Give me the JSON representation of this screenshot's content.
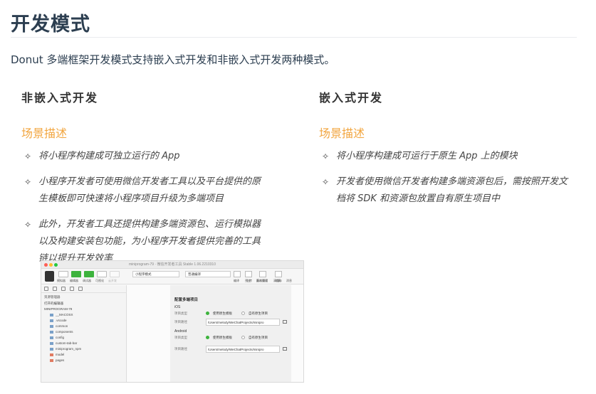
{
  "page": {
    "title": "开发模式",
    "intro": "Donut 多端框架开发模式支持嵌入式开发和非嵌入式开发两种模式。"
  },
  "colors": {
    "accent": "#f2a640",
    "heading": "#2c3e50",
    "green": "#3db33d"
  },
  "columns": [
    {
      "heading": "非嵌入式开发",
      "scene": "场景描述",
      "bullets": [
        "将小程序构建成可独立运行的 App",
        "小程序开发者可使用微信开发者工具以及平台提供的原生模板即可快速将小程序项目升级为多端项目",
        "此外，开发者工具还提供构建多端资源包、运行模拟器以及构建安装包功能，为小程序开发者提供完善的工具链以提升开发效率"
      ]
    },
    {
      "heading": "嵌入式开发",
      "scene": "场景描述",
      "bullets": [
        "将小程序构建成可运行于原生 App 上的模块",
        "开发者使用微信开发者构建多端资源包后，需按照开发文档将 SDK 和资源包放置自有原生项目中"
      ]
    }
  ],
  "bullet_icon": "diamond-star-icon",
  "devtool": {
    "window_title": "miniprogram-79 · 微信开发者工具 Stable 1.06.2210310",
    "toolbar_left_labels": [
      "模拟器",
      "编辑器",
      "调试器",
      "可视化",
      "云开发"
    ],
    "mode_select": "小程序模式",
    "compile_select": "普通编译",
    "toolbar_mid_labels": [
      "编译",
      "预览",
      "真机调试",
      "清缓存"
    ],
    "toolbar_right_labels": [
      "上传",
      "版本管理",
      "详情",
      "消息"
    ],
    "sidebar": {
      "header": "资源管理器",
      "sections": [
        "打开的编辑器",
        "MINIPROGRAM-79"
      ],
      "files": [
        "__MACOSX",
        ".vscode",
        "common",
        "components",
        "config",
        "custom-tab-bar",
        "miniprogram_npm",
        "model",
        "pages"
      ]
    },
    "panel": {
      "title": "配置多端项目",
      "ios_label": "iOS",
      "android_label": "Android",
      "type_label": "项目类型",
      "path_label": "项目路径",
      "option_native": "使用原生模板",
      "option_own": "自有原生项目",
      "ios_path": "/Users/melody/WeChatProjects/minipro",
      "android_path": "/Users/melody/WeChatProjects/minipro"
    }
  }
}
